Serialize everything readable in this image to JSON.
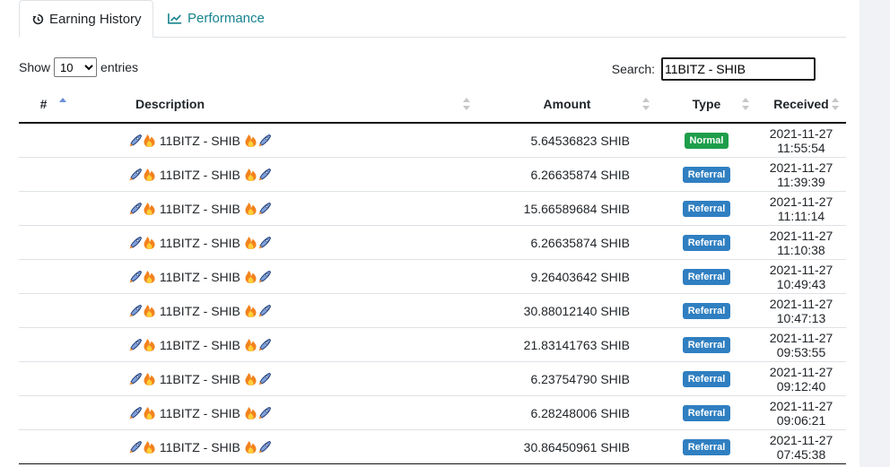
{
  "tabs": [
    {
      "label": "Earning History",
      "icon": "history-icon",
      "active": true
    },
    {
      "label": "Performance",
      "icon": "chart-line-icon",
      "active": false
    }
  ],
  "length": {
    "show_label": "Show",
    "selected": "10",
    "entries_label": "entries"
  },
  "search": {
    "label": "Search:",
    "value": "11BITZ - SHIB"
  },
  "table": {
    "headers": {
      "num": "#",
      "description": "Description",
      "amount": "Amount",
      "type": "Type",
      "received": "Received"
    },
    "rows": [
      {
        "num": "",
        "description": "11BITZ - SHIB",
        "amount": "5.64536823 SHIB",
        "type": "Normal",
        "received": "2021-11-27 11:55:54"
      },
      {
        "num": "",
        "description": "11BITZ - SHIB",
        "amount": "6.26635874 SHIB",
        "type": "Referral",
        "received": "2021-11-27 11:39:39"
      },
      {
        "num": "",
        "description": "11BITZ - SHIB",
        "amount": "15.66589684 SHIB",
        "type": "Referral",
        "received": "2021-11-27 11:11:14"
      },
      {
        "num": "",
        "description": "11BITZ - SHIB",
        "amount": "6.26635874 SHIB",
        "type": "Referral",
        "received": "2021-11-27 11:10:38"
      },
      {
        "num": "",
        "description": "11BITZ - SHIB",
        "amount": "9.26403642 SHIB",
        "type": "Referral",
        "received": "2021-11-27 10:49:43"
      },
      {
        "num": "",
        "description": "11BITZ - SHIB",
        "amount": "30.88012140 SHIB",
        "type": "Referral",
        "received": "2021-11-27 10:47:13"
      },
      {
        "num": "",
        "description": "11BITZ - SHIB",
        "amount": "21.83141763 SHIB",
        "type": "Referral",
        "received": "2021-11-27 09:53:55"
      },
      {
        "num": "",
        "description": "11BITZ - SHIB",
        "amount": "6.23754790 SHIB",
        "type": "Referral",
        "received": "2021-11-27 09:12:40"
      },
      {
        "num": "",
        "description": "11BITZ - SHIB",
        "amount": "6.28248006 SHIB",
        "type": "Referral",
        "received": "2021-11-27 09:06:21"
      },
      {
        "num": "",
        "description": "11BITZ - SHIB",
        "amount": "30.86450961 SHIB",
        "type": "Referral",
        "received": "2021-11-27 07:45:38"
      }
    ]
  },
  "colors": {
    "accent": "#17838f",
    "normal_badge": "#1e9e4a",
    "referral_badge": "#2f7fc1"
  }
}
